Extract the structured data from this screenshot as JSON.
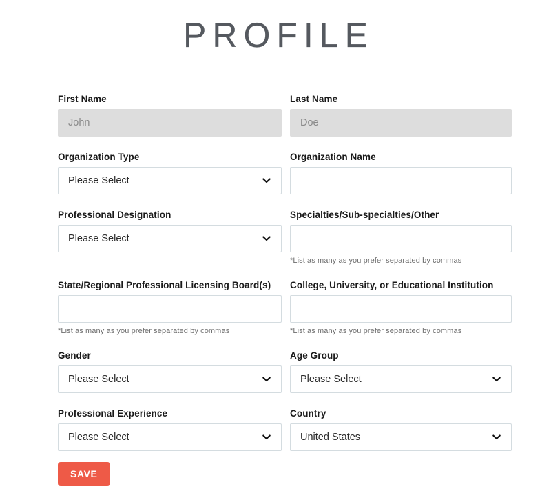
{
  "page": {
    "title": "PROFILE",
    "accent_color": "#ee5a47",
    "border_color": "#d4dce0",
    "disabled_field_color": "#dddddd",
    "title_color": "#55595f"
  },
  "form": {
    "rows": [
      {
        "left": {
          "label": "First Name",
          "type": "text",
          "value": "",
          "placeholder": "John",
          "disabled": true,
          "helper": ""
        },
        "right": {
          "label": "Last Name",
          "type": "text",
          "value": "",
          "placeholder": "Doe",
          "disabled": true,
          "helper": ""
        }
      },
      {
        "left": {
          "label": "Organization Type",
          "type": "select",
          "value": "Please Select",
          "helper": ""
        },
        "right": {
          "label": "Organization Name",
          "type": "text",
          "value": "",
          "placeholder": "",
          "disabled": false,
          "helper": ""
        }
      },
      {
        "left": {
          "label": "Professional Designation",
          "type": "select",
          "value": "Please Select",
          "helper": ""
        },
        "right": {
          "label": "Specialties/Sub-specialties/Other",
          "type": "text",
          "value": "",
          "placeholder": "",
          "disabled": false,
          "helper": "*List as many as you prefer separated by commas"
        }
      },
      {
        "left": {
          "label": "State/Regional Professional Licensing Board(s)",
          "type": "text",
          "value": "",
          "placeholder": "",
          "disabled": false,
          "helper": "*List as many as you prefer separated by commas"
        },
        "right": {
          "label": "College, University, or Educational Institution",
          "type": "text",
          "value": "",
          "placeholder": "",
          "disabled": false,
          "helper": "*List as many as you prefer separated by commas"
        }
      },
      {
        "left": {
          "label": "Gender",
          "type": "select",
          "value": "Please Select",
          "helper": ""
        },
        "right": {
          "label": "Age Group",
          "type": "select",
          "value": "Please Select",
          "helper": ""
        }
      },
      {
        "left": {
          "label": "Professional Experience",
          "type": "select",
          "value": "Please Select",
          "helper": ""
        },
        "right": {
          "label": "Country",
          "type": "select",
          "value": "United States",
          "helper": ""
        }
      }
    ],
    "save_label": "SAVE"
  },
  "icons": {
    "chevron_down": "chevron-down-icon"
  }
}
